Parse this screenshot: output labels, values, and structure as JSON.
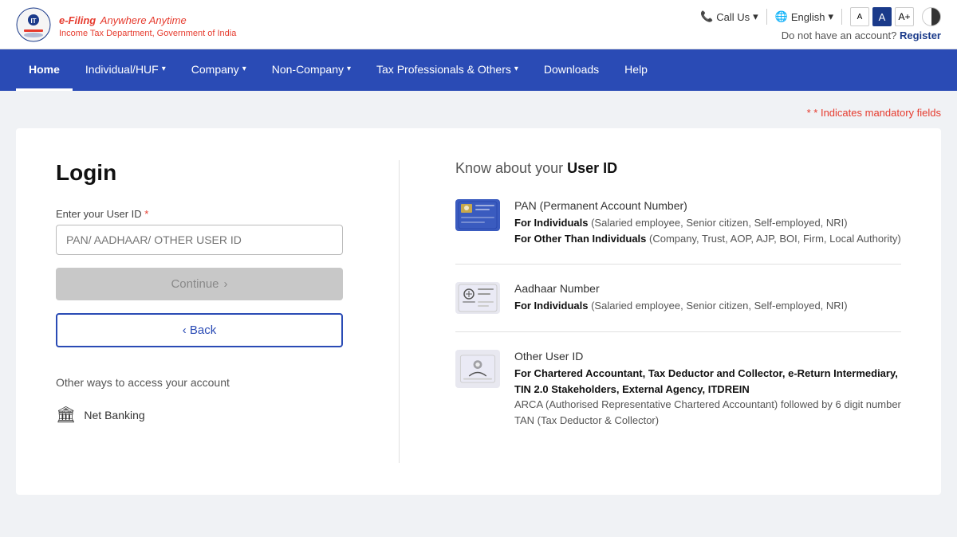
{
  "header": {
    "logo_title": "e-Filing",
    "logo_tagline": "Anywhere Anytime",
    "logo_subtitle": "Income Tax Department, Government of India",
    "call_us": "Call Us",
    "language": "English",
    "font_small": "A",
    "font_medium": "A",
    "font_large": "A+",
    "no_account_text": "Do not have an account?",
    "register_label": "Register"
  },
  "navbar": {
    "items": [
      {
        "label": "Home",
        "active": true,
        "has_dropdown": false
      },
      {
        "label": "Individual/HUF",
        "active": false,
        "has_dropdown": true
      },
      {
        "label": "Company",
        "active": false,
        "has_dropdown": true
      },
      {
        "label": "Non-Company",
        "active": false,
        "has_dropdown": true
      },
      {
        "label": "Tax Professionals & Others",
        "active": false,
        "has_dropdown": true
      },
      {
        "label": "Downloads",
        "active": false,
        "has_dropdown": false
      },
      {
        "label": "Help",
        "active": false,
        "has_dropdown": false
      }
    ]
  },
  "mandatory_note": "* Indicates mandatory fields",
  "login": {
    "title": "Login",
    "user_id_label": "Enter your User ID",
    "user_id_placeholder": "PAN/ AADHAAR/ OTHER USER ID",
    "continue_label": "Continue",
    "continue_arrow": "›",
    "back_label": "‹ Back",
    "other_ways_title": "Other ways to access your account",
    "net_banking_label": "Net Banking"
  },
  "know_user_id": {
    "title_prefix": "Know about your ",
    "title_highlight": "User ID",
    "items": [
      {
        "title": "PAN (Permanent Account Number)",
        "for_individuals_label": "For Individuals",
        "for_individuals_text": "(Salaried employee, Senior citizen, Self-employed, NRI)",
        "for_others_label": "For Other Than Individuals",
        "for_others_text": "(Company, Trust, AOP, AJP, BOI, Firm, Local Authority)"
      },
      {
        "title": "Aadhaar Number",
        "for_individuals_label": "For Individuals",
        "for_individuals_text": "(Salaried employee, Senior citizen, Self-employed, NRI)"
      },
      {
        "title": "Other User ID",
        "for_label": "For Chartered Accountant, Tax Deductor and Collector, e-Return Intermediary, TIN 2.0 Stakeholders, External Agency, ITDREIN",
        "extra1": "ARCA (Authorised Representative Chartered Accountant) followed by 6 digit number",
        "extra2": "TAN (Tax Deductor & Collector)"
      }
    ]
  }
}
